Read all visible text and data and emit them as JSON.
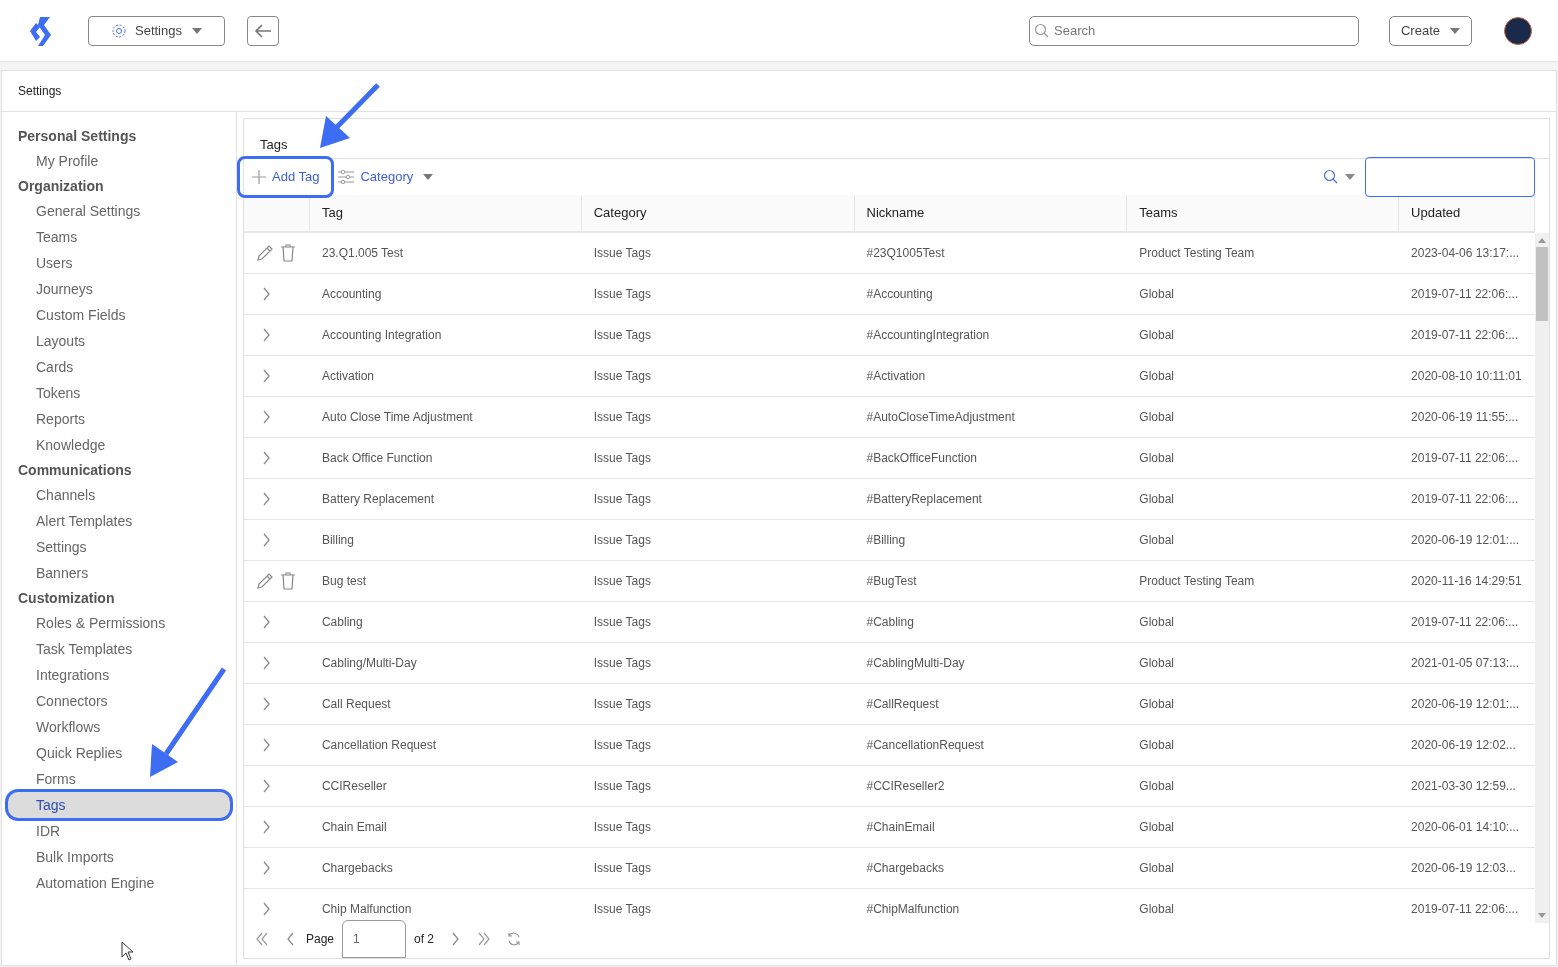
{
  "header": {
    "menu_button": "Settings",
    "search": {
      "placeholder": "Search"
    },
    "create_button": "Create"
  },
  "breadcrumb": "Settings",
  "sidebar": {
    "sections": [
      {
        "title": "Personal Settings",
        "items": [
          {
            "label": "My Profile",
            "selected": false
          }
        ]
      },
      {
        "title": "Organization",
        "items": [
          {
            "label": "General Settings",
            "selected": false
          },
          {
            "label": "Teams",
            "selected": false
          },
          {
            "label": "Users",
            "selected": false
          },
          {
            "label": "Journeys",
            "selected": false
          },
          {
            "label": "Custom Fields",
            "selected": false
          },
          {
            "label": "Layouts",
            "selected": false
          },
          {
            "label": "Cards",
            "selected": false
          },
          {
            "label": "Tokens",
            "selected": false
          },
          {
            "label": "Reports",
            "selected": false
          },
          {
            "label": "Knowledge",
            "selected": false
          }
        ]
      },
      {
        "title": "Communications",
        "items": [
          {
            "label": "Channels",
            "selected": false
          },
          {
            "label": "Alert Templates",
            "selected": false
          },
          {
            "label": "Settings",
            "selected": false
          },
          {
            "label": "Banners",
            "selected": false
          }
        ]
      },
      {
        "title": "Customization",
        "items": [
          {
            "label": "Roles & Permissions",
            "selected": false
          },
          {
            "label": "Task Templates",
            "selected": false
          },
          {
            "label": "Integrations",
            "selected": false
          },
          {
            "label": "Connectors",
            "selected": false
          },
          {
            "label": "Workflows",
            "selected": false
          },
          {
            "label": "Quick Replies",
            "selected": false
          },
          {
            "label": "Forms",
            "selected": false
          },
          {
            "label": "Tags",
            "selected": true
          },
          {
            "label": "IDR",
            "selected": false
          },
          {
            "label": "Bulk Imports",
            "selected": false
          },
          {
            "label": "Automation Engine",
            "selected": false
          }
        ]
      }
    ]
  },
  "panel": {
    "title": "Tags",
    "add_button": "Add Tag",
    "category_filter": "Category"
  },
  "table": {
    "columns": [
      "Tag",
      "Category",
      "Nickname",
      "Teams",
      "Updated"
    ],
    "rows": [
      {
        "kind": "editable",
        "cells": [
          "23.Q1.005 Test",
          "Issue Tags",
          "#23Q1005Test",
          "Product Testing Team",
          "2023-04-06 13:17:..."
        ]
      },
      {
        "kind": "collapsed",
        "cells": [
          "Accounting",
          "Issue Tags",
          "#Accounting",
          "Global",
          "2019-07-11 22:06:..."
        ]
      },
      {
        "kind": "collapsed",
        "cells": [
          "Accounting Integration",
          "Issue Tags",
          "#AccountingIntegration",
          "Global",
          "2019-07-11 22:06:..."
        ]
      },
      {
        "kind": "collapsed",
        "cells": [
          "Activation",
          "Issue Tags",
          "#Activation",
          "Global",
          "2020-08-10 10:11:01"
        ]
      },
      {
        "kind": "collapsed",
        "cells": [
          "Auto Close Time Adjustment",
          "Issue Tags",
          "#AutoCloseTimeAdjustment",
          "Global",
          "2020-06-19 11:55:..."
        ]
      },
      {
        "kind": "collapsed",
        "cells": [
          "Back Office Function",
          "Issue Tags",
          "#BackOfficeFunction",
          "Global",
          "2019-07-11 22:06:..."
        ]
      },
      {
        "kind": "collapsed",
        "cells": [
          "Battery Replacement",
          "Issue Tags",
          "#BatteryReplacement",
          "Global",
          "2019-07-11 22:06:..."
        ]
      },
      {
        "kind": "collapsed",
        "cells": [
          "Billing",
          "Issue Tags",
          "#Billing",
          "Global",
          "2020-06-19 12:01:..."
        ]
      },
      {
        "kind": "editable",
        "cells": [
          "Bug test",
          "Issue Tags",
          "#BugTest",
          "Product Testing Team",
          "2020-11-16 14:29:51"
        ]
      },
      {
        "kind": "collapsed",
        "cells": [
          "Cabling",
          "Issue Tags",
          "#Cabling",
          "Global",
          "2019-07-11 22:06:..."
        ]
      },
      {
        "kind": "collapsed",
        "cells": [
          "Cabling/Multi-Day",
          "Issue Tags",
          "#CablingMulti-Day",
          "Global",
          "2021-01-05 07:13:..."
        ]
      },
      {
        "kind": "collapsed",
        "cells": [
          "Call Request",
          "Issue Tags",
          "#CallRequest",
          "Global",
          "2020-06-19 12:01:..."
        ]
      },
      {
        "kind": "collapsed",
        "cells": [
          "Cancellation Request",
          "Issue Tags",
          "#CancellationRequest",
          "Global",
          "2020-06-19 12:02..."
        ]
      },
      {
        "kind": "collapsed",
        "cells": [
          "CCIReseller",
          "Issue Tags",
          "#CCIReseller2",
          "Global",
          "2021-03-30 12:59..."
        ]
      },
      {
        "kind": "collapsed",
        "cells": [
          "Chain Email",
          "Issue Tags",
          "#ChainEmail",
          "Global",
          "2020-06-01 14:10:..."
        ]
      },
      {
        "kind": "collapsed",
        "cells": [
          "Chargebacks",
          "Issue Tags",
          "#Chargebacks",
          "Global",
          "2020-06-19 12:03..."
        ]
      },
      {
        "kind": "collapsed",
        "cells": [
          "Chip Malfunction",
          "Issue Tags",
          "#ChipMalfunction",
          "Global",
          "2019-07-11 22:06:..."
        ]
      }
    ]
  },
  "pagination": {
    "page_label": "Page",
    "page_value": "1",
    "of_label": "of 2"
  }
}
